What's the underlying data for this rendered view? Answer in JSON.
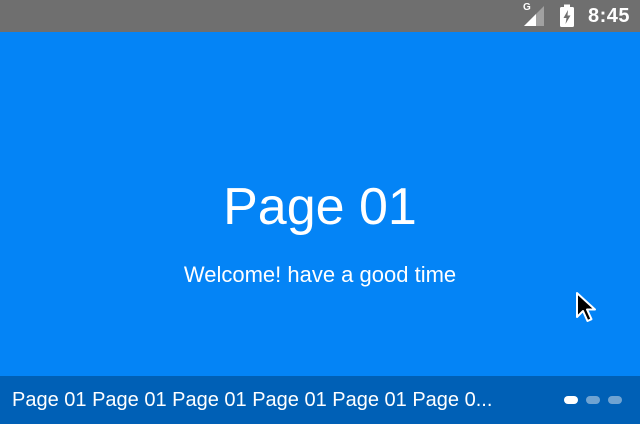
{
  "status_bar": {
    "network_type": "G",
    "time": "8:45",
    "background_color": "#6f6f6f",
    "icons": [
      "signal-icon",
      "battery-charging-icon"
    ]
  },
  "page": {
    "title": "Page 01",
    "subtitle": "Welcome! have a good time",
    "background_color": "#0484f6"
  },
  "tab_strip": {
    "titles_text": "Page 01 Page 01 Page 01 Page 01 Page 01 Page 0...",
    "background_color": "#0060b6",
    "indicator_count": 3,
    "active_indicator": 1
  }
}
